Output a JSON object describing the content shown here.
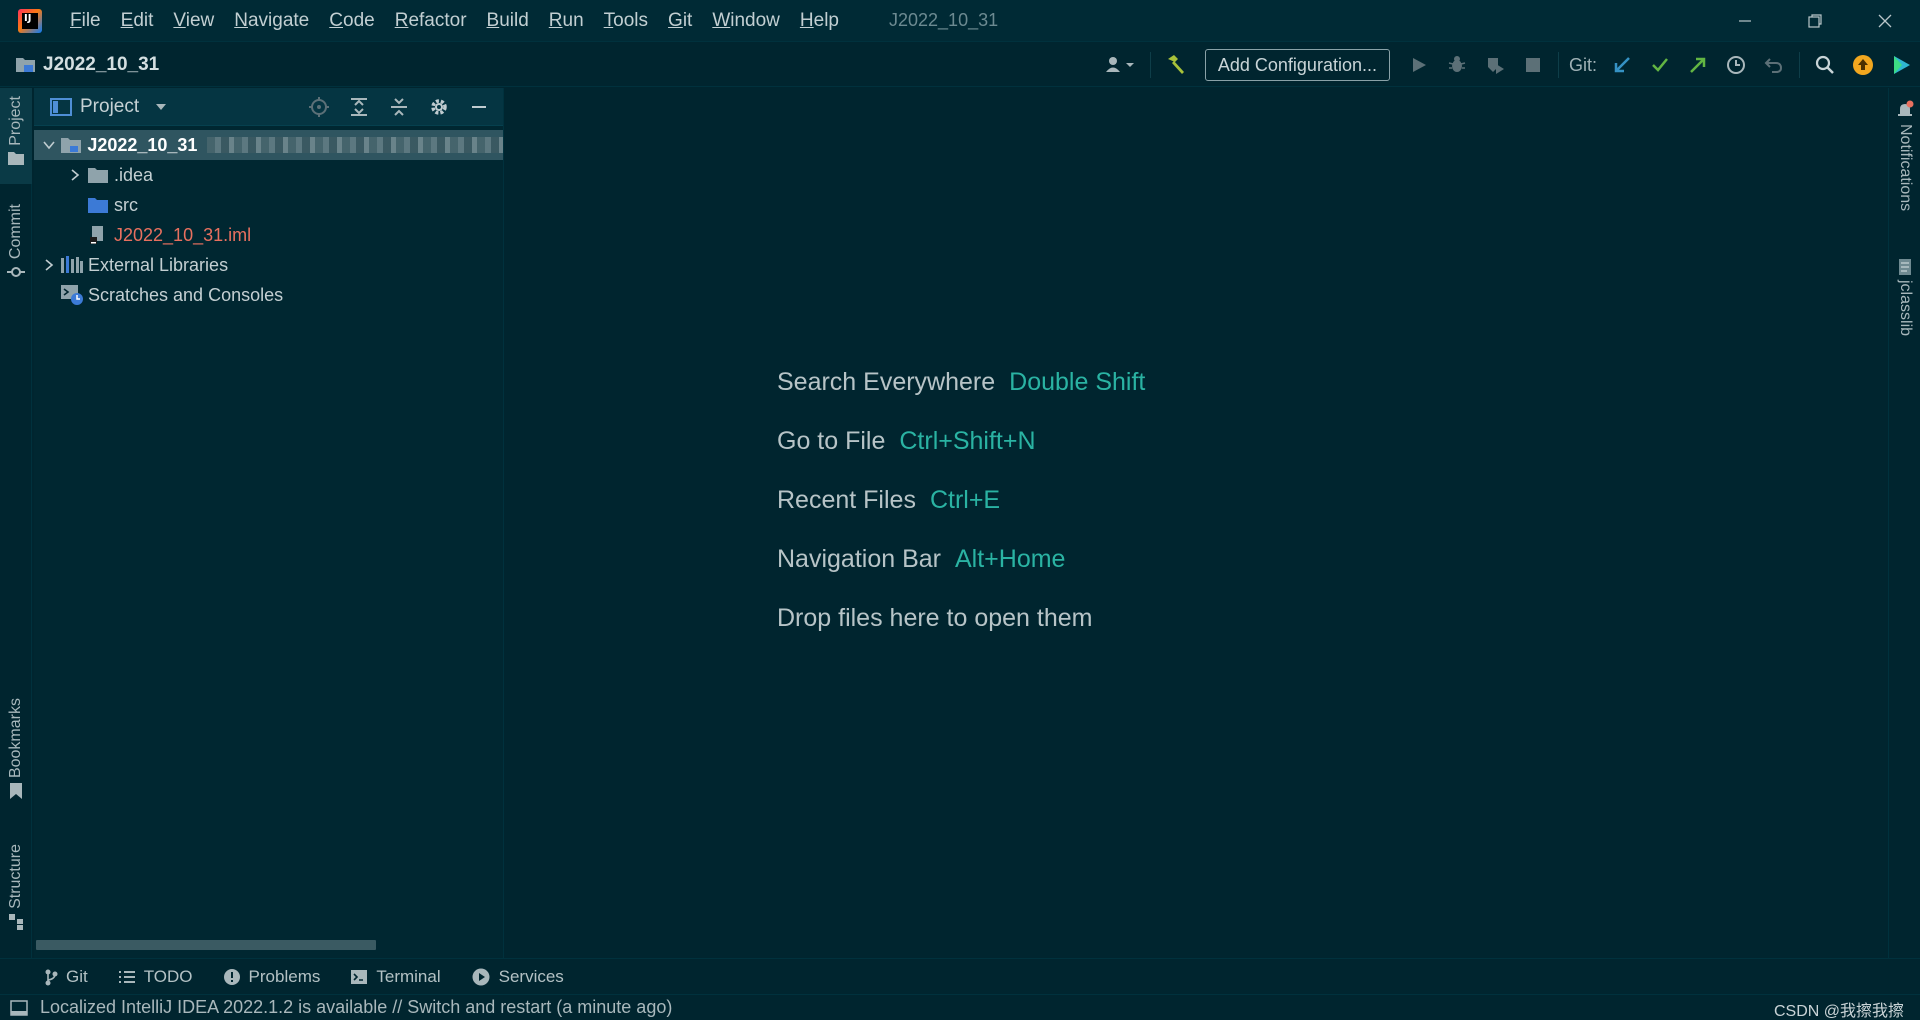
{
  "titlebar": {
    "app_logo_text": "IJ",
    "menu": [
      {
        "label": "File",
        "mnemonic": "F",
        "rest": "ile"
      },
      {
        "label": "Edit",
        "mnemonic": "E",
        "rest": "dit"
      },
      {
        "label": "View",
        "mnemonic": "V",
        "rest": "iew"
      },
      {
        "label": "Navigate",
        "mnemonic": "N",
        "rest": "avigate"
      },
      {
        "label": "Code",
        "mnemonic": "C",
        "rest": "ode"
      },
      {
        "label": "Refactor",
        "mnemonic": "R",
        "rest": "efactor"
      },
      {
        "label": "Build",
        "mnemonic": "B",
        "rest": "uild"
      },
      {
        "label": "Run",
        "mnemonic": "R",
        "rest": "un"
      },
      {
        "label": "Tools",
        "mnemonic": "T",
        "rest": "ools"
      },
      {
        "label": "Git",
        "mnemonic": "G",
        "rest": "it"
      },
      {
        "label": "Window",
        "mnemonic": "W",
        "rest": "indow"
      },
      {
        "label": "Help",
        "mnemonic": "H",
        "rest": "elp"
      }
    ],
    "window_title": "J2022_10_31"
  },
  "navbar": {
    "project_name": "J2022_10_31",
    "add_configuration": "Add Configuration...",
    "git_label": "Git:"
  },
  "left_strip": {
    "project": "Project",
    "commit": "Commit",
    "bookmarks": "Bookmarks",
    "structure": "Structure"
  },
  "right_strip": {
    "notifications": "Notifications",
    "jclasslib": "jclasslib"
  },
  "project_panel": {
    "title": "Project",
    "tree": [
      {
        "label": "J2022_10_31",
        "type": "module-root"
      },
      {
        "label": ".idea",
        "type": "folder"
      },
      {
        "label": "src",
        "type": "source-folder"
      },
      {
        "label": "J2022_10_31.iml",
        "type": "iml-file"
      },
      {
        "label": "External Libraries",
        "type": "libraries"
      },
      {
        "label": "Scratches and Consoles",
        "type": "scratches"
      }
    ]
  },
  "editor": {
    "hints": [
      {
        "label": "Search Everywhere",
        "key": "Double Shift"
      },
      {
        "label": "Go to File",
        "key": "Ctrl+Shift+N"
      },
      {
        "label": "Recent Files",
        "key": "Ctrl+E"
      },
      {
        "label": "Navigation Bar",
        "key": "Alt+Home"
      },
      {
        "label": "Drop files here to open them",
        "key": ""
      }
    ]
  },
  "bottom_tools": {
    "git": "Git",
    "todo": "TODO",
    "problems": "Problems",
    "terminal": "Terminal",
    "services": "Services"
  },
  "statusbar": {
    "message": "Localized IntelliJ IDEA 2022.1.2 is available // Switch and restart (a minute ago)",
    "watermark": "CSDN @我擦我擦"
  },
  "colors": {
    "background": "#00252f",
    "accent_key": "#2ab3a3",
    "selection": "#2f5560",
    "iml_file_text": "#e8705f",
    "git_update": "#3592c4",
    "git_commit": "#62b543",
    "git_push": "#62b543"
  }
}
